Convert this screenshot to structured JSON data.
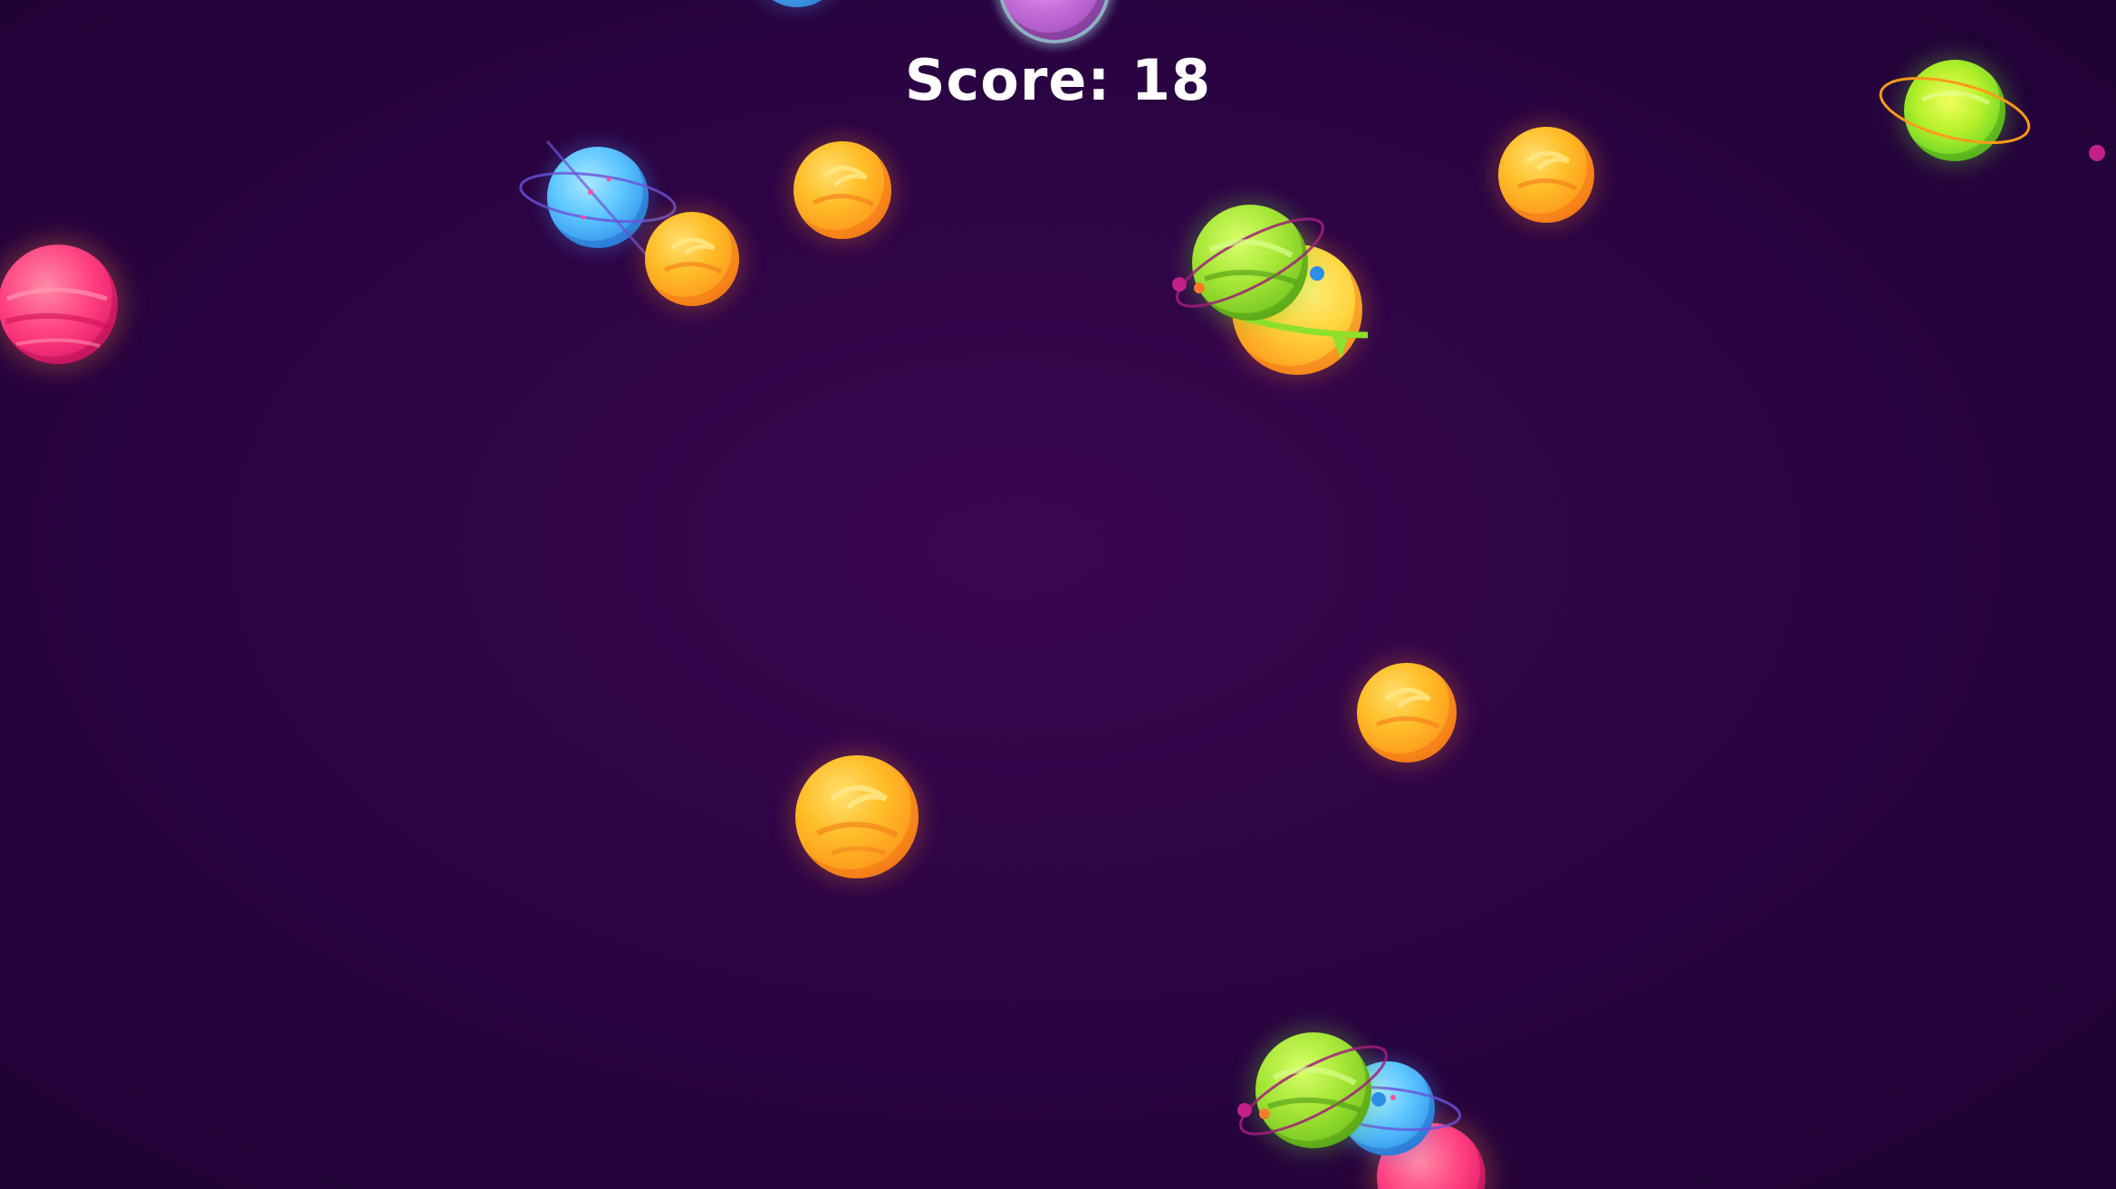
{
  "hud": {
    "score_label": "Score: 18"
  },
  "colors": {
    "background": "#2c0444",
    "orange_planet": "#ffb224",
    "blue_planet": "#4fb8ff",
    "green_planet": "#9ae032",
    "pink_planet": "#ff3f7f",
    "violet_planet": "#c56ed8",
    "score_text": "#ffffff"
  },
  "planets": [
    {
      "id": "pink-left",
      "type": "pink"
    },
    {
      "id": "blue-ringed-top",
      "type": "blue"
    },
    {
      "id": "orange-top-a",
      "type": "orange"
    },
    {
      "id": "orange-top-b",
      "type": "orange"
    },
    {
      "id": "green-ringed-mid",
      "type": "green"
    },
    {
      "id": "orange-yellow-behind-green",
      "type": "orange"
    },
    {
      "id": "orange-top-right",
      "type": "orange"
    },
    {
      "id": "green-ringed-top-right",
      "type": "green"
    },
    {
      "id": "orange-center-right",
      "type": "orange"
    },
    {
      "id": "orange-center",
      "type": "orange"
    },
    {
      "id": "green-ringed-bottom",
      "type": "green"
    },
    {
      "id": "blue-bottom",
      "type": "blue"
    },
    {
      "id": "pink-bottom",
      "type": "pink"
    },
    {
      "id": "violet-top-edge",
      "type": "violet"
    },
    {
      "id": "blue-top-edge",
      "type": "blue"
    }
  ]
}
